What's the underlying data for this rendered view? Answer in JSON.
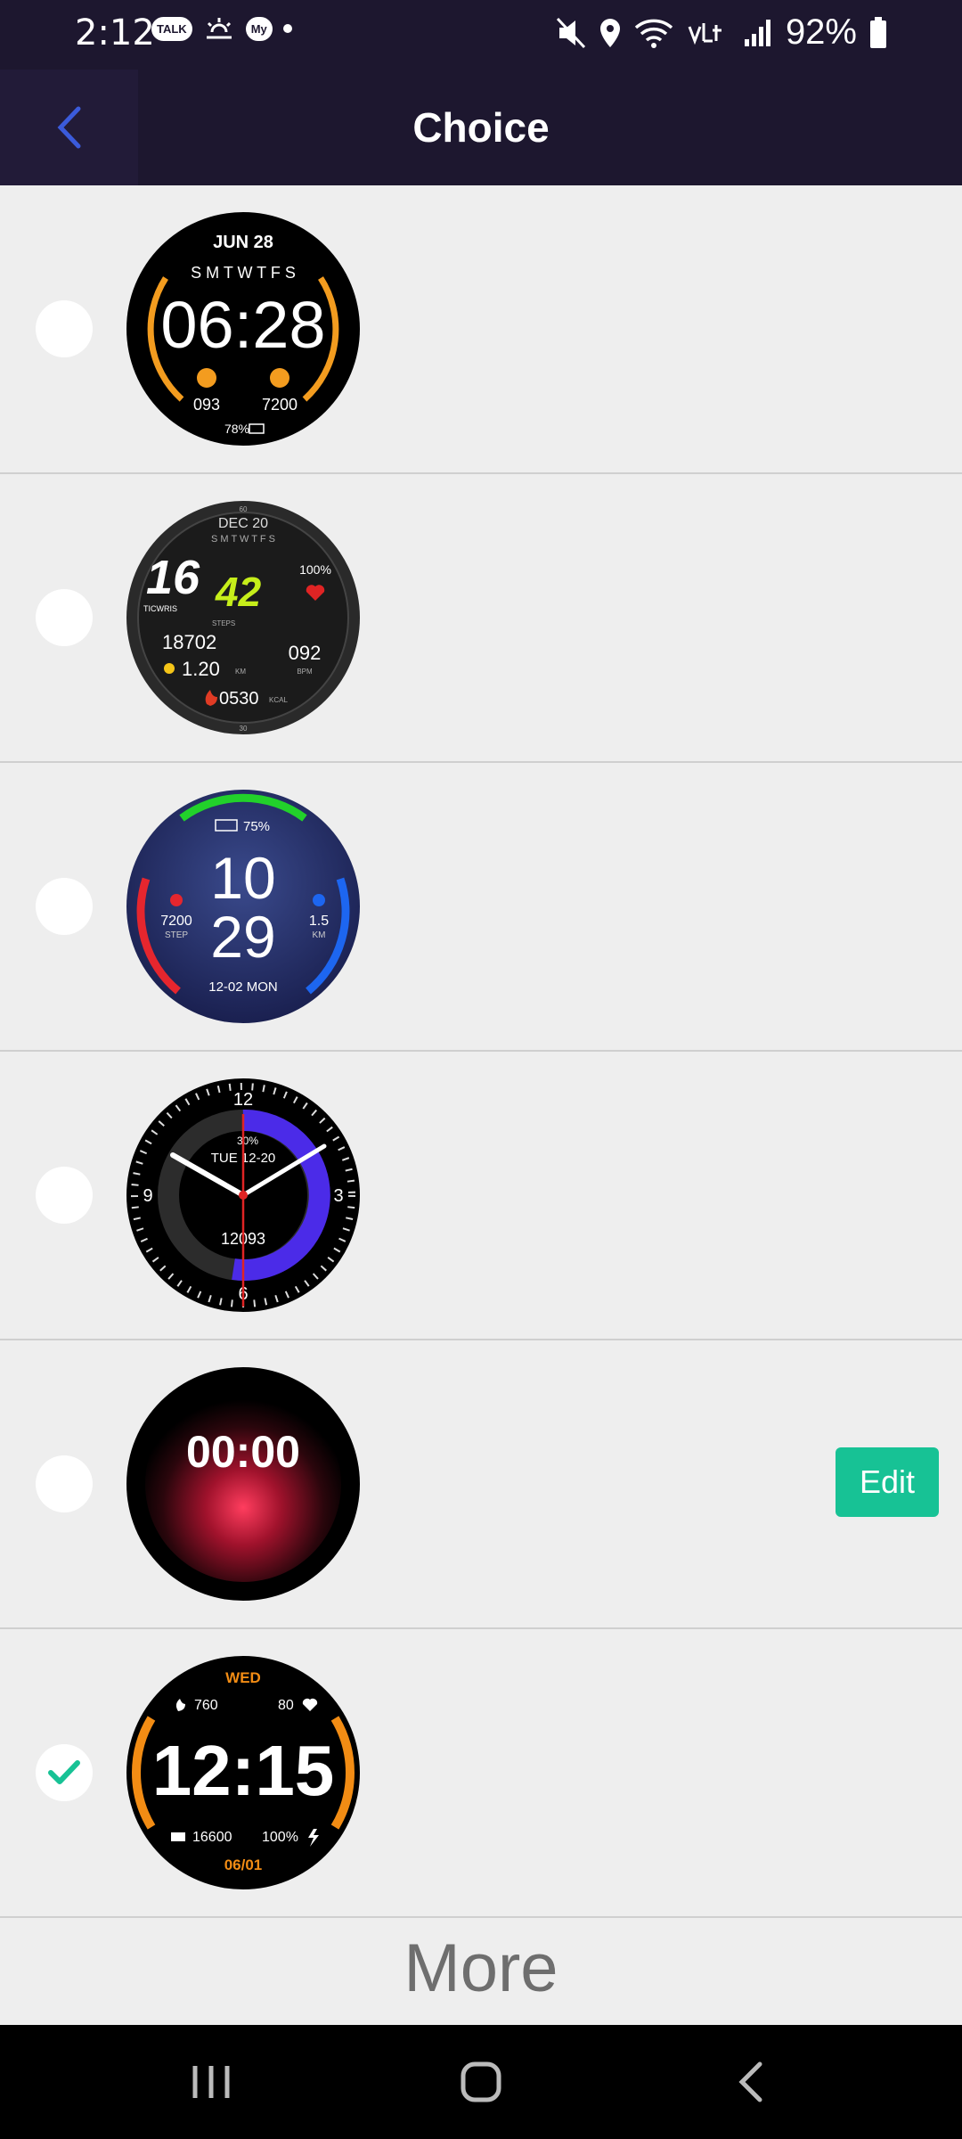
{
  "status_bar": {
    "time": "2:12",
    "talk_badge": "TALK",
    "my_badge": "My",
    "battery_percent": "92%",
    "icons": [
      "talk-icon",
      "weather-icon",
      "my-icon",
      "dot-icon",
      "mute-icon",
      "location-icon",
      "wifi-icon",
      "volte-icon",
      "signal-icon",
      "battery-icon"
    ]
  },
  "header": {
    "title": "Choice",
    "back_icon": "chevron-left-icon"
  },
  "colors": {
    "accent_green": "#17c295",
    "bar_bg": "#1d172f",
    "back_icon": "#3b5bdb"
  },
  "faces": [
    {
      "id": "face-1",
      "selected": false,
      "date": "JUN 28",
      "weekdays": "S M T W T F S",
      "time": "06:28",
      "heart": "093",
      "steps": "7200",
      "battery": "78%"
    },
    {
      "id": "face-2",
      "selected": false,
      "date": "DEC 20",
      "weekdays": "S M T W T F S",
      "hour": "16",
      "minute": "42",
      "battery": "100%",
      "brand": "TICWRIS",
      "steps_label": "STEPS",
      "steps": "18702",
      "distance": "1.20",
      "distance_unit": "KM",
      "bpm": "092",
      "bpm_unit": "BPM",
      "kcal": "0530",
      "kcal_unit": "KCAL",
      "top_mark": "60",
      "bottom_mark": "30"
    },
    {
      "id": "face-3",
      "selected": false,
      "battery": "75%",
      "hour": "10",
      "minute": "29",
      "steps": "7200",
      "steps_label": "STEP",
      "distance": "1.5",
      "distance_unit": "KM",
      "date": "12-02 MON"
    },
    {
      "id": "face-4",
      "selected": false,
      "n12": "12",
      "n3": "3",
      "n6": "6",
      "n9": "9",
      "battery": "30%",
      "date": "TUE 12-20",
      "steps": "12093"
    },
    {
      "id": "face-5",
      "selected": false,
      "time": "00:00",
      "edit_label": "Edit"
    },
    {
      "id": "face-6",
      "selected": true,
      "day": "WED",
      "calories": "760",
      "heart": "80",
      "time": "12:15",
      "steps": "16600",
      "battery": "100%",
      "date": "06/01"
    }
  ],
  "more_label": "More",
  "nav_bar": {
    "items": [
      "recents-icon",
      "home-icon",
      "back-icon"
    ]
  }
}
